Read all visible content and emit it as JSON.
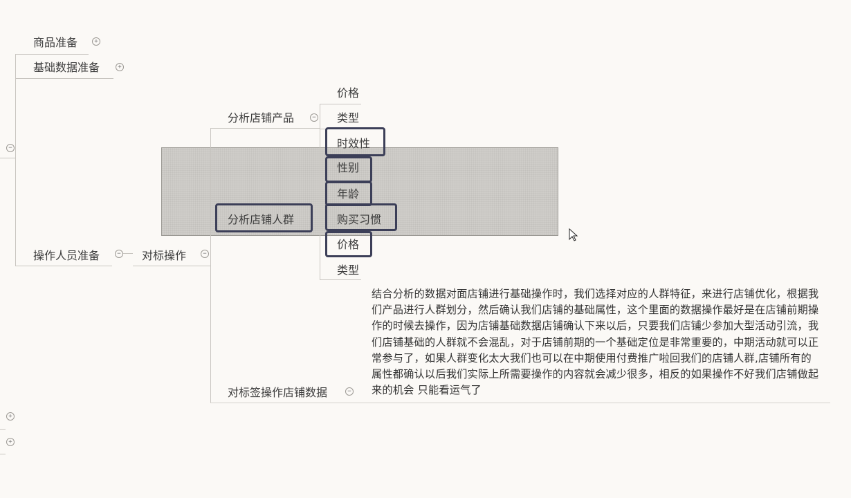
{
  "nodes": {
    "goods_prep": "商品准备",
    "base_data_prep": "基础数据准备",
    "operator_prep": "操作人员准备",
    "benchmark_op": "对标操作",
    "analyze_product": "分析店铺产品",
    "analyze_crowd": "分析店铺人群",
    "benchmark_data": "对标签操作店铺数据",
    "product_children": [
      "价格",
      "类型",
      "时效性"
    ],
    "crowd_children": [
      "性别",
      "年龄",
      "购买习惯",
      "价格",
      "类型"
    ]
  },
  "toggles": {
    "collapsed": "+",
    "expanded": "−"
  },
  "paragraph": "结合分析的数据对面店铺进行基础操作时，我们选择对应的人群特征，来进行店铺优化，根据我们产品进行人群划分，然后确认我们店铺的基础属性，这个里面的数据操作最好是在店铺前期操作的时候去操作，因为店铺基础数据店铺确认下来以后，只要我们店铺少参加大型活动引流，我们店铺基础的人群就不会混乱，对于店铺前期的一个基础定位是非常重要的，中期活动就可以正常参与了，如果人群变化太大我们也可以在中期使用付费推广啦回我们的店铺人群,店铺所有的属性都确认以后我们实际上所需要操作的内容就会减少很多，相反的如果操作不好我们店铺做起来的机会 只能看运气了"
}
